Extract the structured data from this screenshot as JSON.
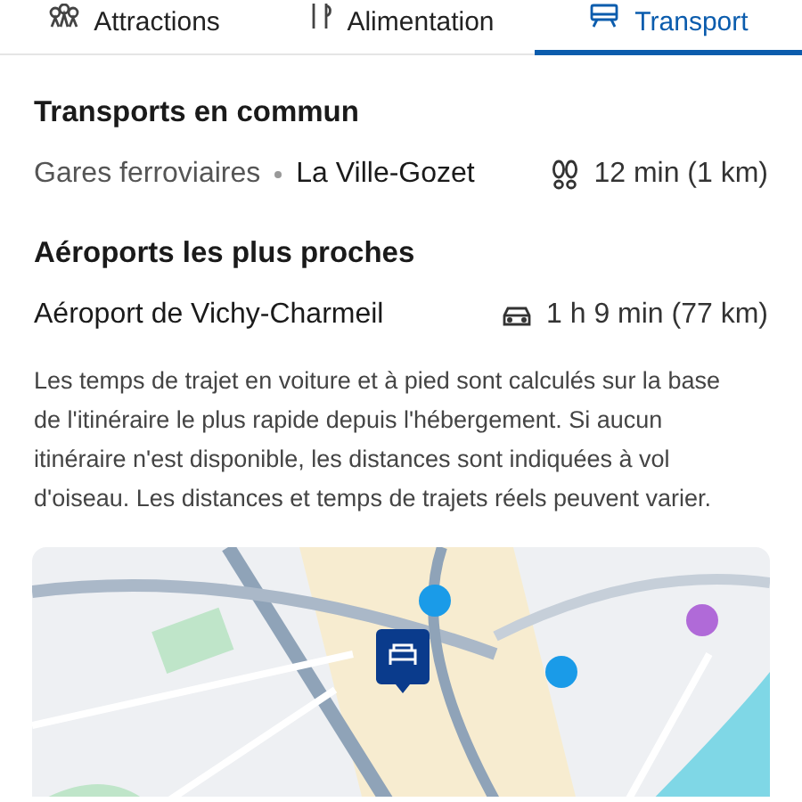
{
  "tabs": [
    {
      "label": "Attractions",
      "kind": "attractions",
      "selected": false
    },
    {
      "label": "Alimentation",
      "kind": "food",
      "selected": false
    },
    {
      "label": "Transport",
      "kind": "transport",
      "selected": true
    }
  ],
  "sections": [
    {
      "title": "Transports en commun",
      "rows": [
        {
          "category": "Gares ferroviaires",
          "place": "La Ville-Gozet",
          "kind": "walk",
          "distance": "12 min (1 km)"
        }
      ]
    },
    {
      "title": "Aéroports les plus proches",
      "rows": [
        {
          "place": "Aéroport de Vichy-Charmeil",
          "kind": "car",
          "distance": "1 h 9 min (77 km)"
        }
      ]
    }
  ],
  "note": "Les temps de trajet en voiture et à pied sont calculés sur la base de l'itinéraire le plus rapide depuis l'hébergement. Si aucun itinéraire n'est disponible, les distances sont indiquées à vol d'oiseau. Les distances et temps de trajets réels peuvent varier."
}
